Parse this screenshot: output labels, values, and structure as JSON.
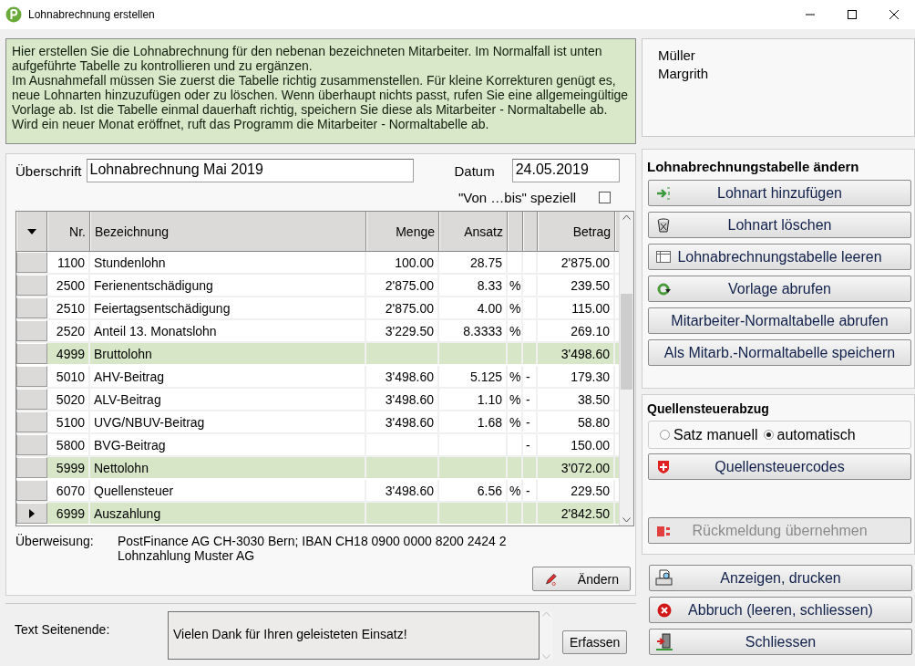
{
  "window": {
    "title": "Lohnabrechnung erstellen"
  },
  "info": {
    "paragraphs": [
      "Hier erstellen Sie die Lohnabrechnung für den nebenan bezeichneten Mitarbeiter. Im Normalfall ist unten aufgeführte Tabelle zu kontrollieren und zu ergänzen.",
      "Im Ausnahmefall müssen Sie zuerst die Tabelle richtig zusammenstellen. Für kleine Korrekturen genügt es, neue Lohnarten hinzuzufügen oder zu löschen. Wenn überhaupt nichts passt, rufen Sie eine allgemeingültige Vorlage ab. Ist die Tabelle einmal dauerhaft richtig, speichern Sie diese als Mitarbeiter - Normaltabelle ab. Wird ein neuer Monat eröffnet, ruft das Programm die Mitarbeiter - Normaltabelle ab."
    ]
  },
  "employee": {
    "lines": [
      "Müller",
      "Margrith"
    ]
  },
  "form": {
    "heading_label": "Überschrift",
    "heading_value": "Lohnabrechnung Mai 2019",
    "date_label": "Datum",
    "date_value": "24.05.2019",
    "special_label": "\"Von …bis\" speziell",
    "special_checked": false
  },
  "table": {
    "columns": {
      "nr": "Nr.",
      "name": "Bezeichnung",
      "quantity": "Menge",
      "rate": "Ansatz",
      "amount": "Betrag"
    },
    "rows": [
      {
        "kind": "item",
        "selected": false,
        "nr": "1100",
        "name": "Stundenlohn",
        "quantity": "100.00",
        "rate": "28.75",
        "amount": "2'875.00"
      },
      {
        "kind": "item",
        "selected": false,
        "nr": "2500",
        "name": "Ferienentschädigung",
        "quantity": "2'875.00",
        "rate": "8.33",
        "unit": "%",
        "amount": "239.50"
      },
      {
        "kind": "item",
        "selected": false,
        "nr": "2510",
        "name": "Feiertagsentschädigung",
        "quantity": "2'875.00",
        "rate": "4.00",
        "unit": "%",
        "amount": "115.00"
      },
      {
        "kind": "item",
        "selected": false,
        "nr": "2520",
        "name": "Anteil 13. Monatslohn",
        "quantity": "3'229.50",
        "rate": "8.3333",
        "unit": "%",
        "amount": "269.10"
      },
      {
        "kind": "total",
        "selected": false,
        "nr": "4999",
        "name": "Bruttolohn",
        "amount": "3'498.60"
      },
      {
        "kind": "item",
        "selected": false,
        "nr": "5010",
        "name": "AHV-Beitrag",
        "quantity": "3'498.60",
        "rate": "5.125",
        "unit": "%",
        "sign": "-",
        "amount": "179.30"
      },
      {
        "kind": "item",
        "selected": false,
        "nr": "5020",
        "name": "ALV-Beitrag",
        "quantity": "3'498.60",
        "rate": "1.10",
        "unit": "%",
        "sign": "-",
        "amount": "38.50"
      },
      {
        "kind": "item",
        "selected": false,
        "nr": "5100",
        "name": "UVG/NBUV-Beitrag",
        "quantity": "3'498.60",
        "rate": "1.68",
        "unit": "%",
        "sign": "-",
        "amount": "58.80"
      },
      {
        "kind": "item",
        "selected": false,
        "nr": "5800",
        "name": "BVG-Beitrag",
        "sign": "-",
        "amount": "150.00"
      },
      {
        "kind": "total",
        "selected": false,
        "nr": "5999",
        "name": "Nettolohn",
        "amount": "3'072.00"
      },
      {
        "kind": "item",
        "selected": false,
        "nr": "6070",
        "name": "Quellensteuer",
        "quantity": "3'498.60",
        "rate": "6.56",
        "unit": "%",
        "sign": "-",
        "amount": "229.50"
      },
      {
        "kind": "total",
        "selected": true,
        "nr": "6999",
        "name": "Auszahlung",
        "amount": "2'842.50"
      }
    ]
  },
  "transfer": {
    "label": "Überweisung:",
    "lines": [
      "PostFinance AG CH-3030 Bern; IBAN CH18 0900 0000 8200 2424 2",
      "Lohnzahlung Muster AG"
    ],
    "edit_button": "Ändern"
  },
  "footer_text": {
    "label": "Text Seitenende:",
    "value": "Vielen Dank für Ihren geleisteten Einsatz!",
    "button": "Erfassen"
  },
  "table_actions": {
    "title": "Lohnabrechnungstabelle ändern",
    "buttons": [
      {
        "label": "Lohnart hinzufügen"
      },
      {
        "label": "Lohnart löschen"
      },
      {
        "label": "Lohnabrechnungstabelle leeren"
      },
      {
        "label": "Vorlage abrufen"
      },
      {
        "label": "Mitarbeiter-Normaltabelle abrufen"
      },
      {
        "label": "Als Mitarb.-Normaltabelle speichern"
      }
    ]
  },
  "withholding": {
    "title": "Quellensteuerabzug",
    "options": [
      {
        "label": "Satz manuell",
        "selected": false
      },
      {
        "label": "automatisch",
        "selected": true
      }
    ],
    "codes_button": {
      "label": "Quellensteuercodes"
    },
    "feedback_button": {
      "label": "Rückmeldung übernehmen",
      "disabled": true
    }
  },
  "actions": [
    {
      "label": "Anzeigen, drucken"
    },
    {
      "label": "Abbruch (leeren, schliessen)"
    },
    {
      "label": "Schliessen"
    }
  ]
}
